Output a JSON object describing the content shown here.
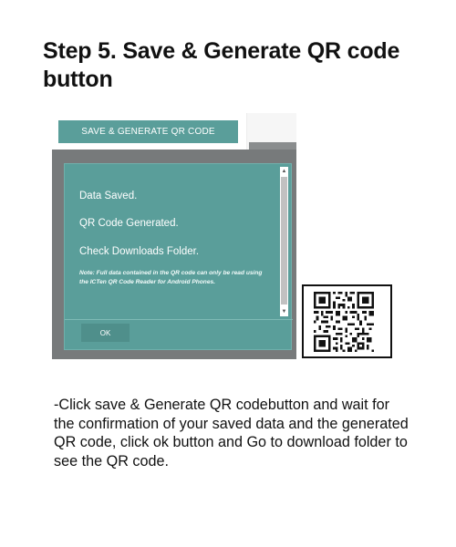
{
  "page": {
    "title": "Step 5. Save & Generate QR code button",
    "instructions": "-Click save & Generate QR codebutton and wait for the confirmation of your saved data and the generated QR code, click ok button and  Go to download folder to see the QR code."
  },
  "app": {
    "save_button_label": "SAVE & GENERATE QR CODE"
  },
  "dialog": {
    "line1": "Data Saved.",
    "line2": "QR Code Generated.",
    "line3": "Check Downloads Folder.",
    "note": "Note: Full data contained in the QR code can only be read using the ICTen QR Code Reader for Android Phones.",
    "ok_label": "OK"
  },
  "colors": {
    "accent": "#5a9e9a",
    "overlay": "#777a7b"
  }
}
